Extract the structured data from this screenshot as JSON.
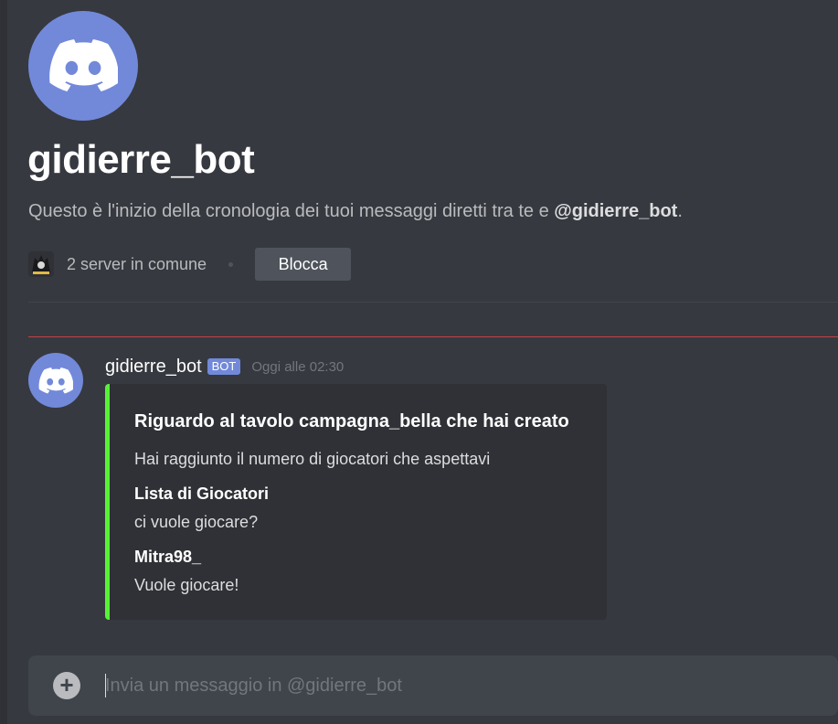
{
  "dm_header": {
    "username": "gidierre_bot",
    "description_prefix": "Questo è l'inizio della cronologia dei tuoi messaggi diretti tra te e ",
    "description_mention": "@gidierre_bot",
    "description_suffix": ".",
    "mutual_servers": "2 server in comune",
    "block_label": "Blocca"
  },
  "message": {
    "author": "gidierre_bot",
    "badge": "BOT",
    "timestamp": "Oggi alle 02:30",
    "embed": {
      "accent_color": "#57f236",
      "title": "Riguardo al tavolo campagna_bella che hai creato",
      "description": "Hai raggiunto il numero di giocatori che aspettavi",
      "fields": [
        {
          "name": "Lista di Giocatori",
          "value": "ci vuole giocare?"
        },
        {
          "name": "Mitra98_",
          "value": "Vuole giocare!"
        }
      ]
    }
  },
  "composer": {
    "placeholder": "Invia un messaggio in @gidierre_bot"
  },
  "colors": {
    "background": "#36393f",
    "blurple": "#7289da",
    "new_messages_divider": "#ed4245"
  }
}
